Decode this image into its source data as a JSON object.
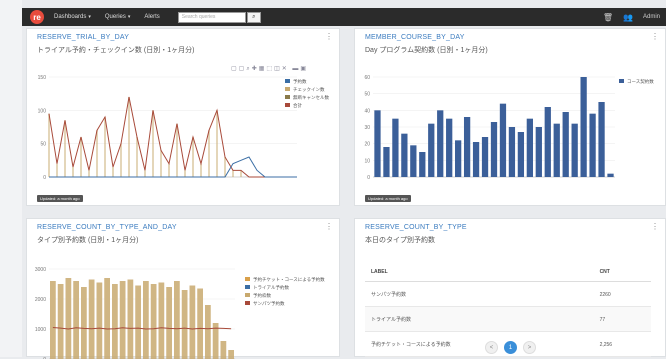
{
  "topbar": {
    "logo_text": "re",
    "nav": [
      {
        "label": "Dashboards",
        "caret": true
      },
      {
        "label": "Queries",
        "caret": true
      },
      {
        "label": "Alerts",
        "caret": false
      }
    ],
    "search_placeholder": "Search queries",
    "user": "Admin"
  },
  "panels": {
    "p1": {
      "title": "RESERVE_TRIAL_BY_DAY",
      "subtitle": "トライアル予約・チェックイン数 (日別・1ヶ月分)",
      "updated": "Updated: a month ago"
    },
    "p2": {
      "title": "MEMBER_COURSE_BY_DAY",
      "subtitle": "Day プログラム契約数 (日別・1ヶ月分)",
      "updated": "Updated: a month ago"
    },
    "p3": {
      "title": "RESERVE_COUNT_BY_TYPE_AND_DAY",
      "subtitle": "タイプ別予約数 (日別・1ヶ月分)"
    },
    "p4": {
      "title": "RESERVE_COUNT_BY_TYPE",
      "subtitle": "本日のタイプ別予約数"
    }
  },
  "table": {
    "headers": [
      "LABEL",
      "CNT"
    ],
    "rows": [
      {
        "label": "サンパツ予約数",
        "cnt": "2260"
      },
      {
        "label": "トライアル予約数",
        "cnt": "77"
      },
      {
        "label": "予約チケット・コースによる予約数",
        "cnt": "2,256"
      }
    ],
    "pages": [
      "<",
      "1",
      ">"
    ]
  },
  "chart_data": [
    {
      "type": "line",
      "legend": [
        "予約数",
        "チェックイン数",
        "無断キャンセル数",
        "合計"
      ],
      "colors": [
        "#3b6ea5",
        "#c8a96e",
        "#8a7a4a",
        "#a84a3a"
      ],
      "ylim": [
        0,
        150
      ],
      "yticks": [
        0,
        50,
        100,
        150
      ],
      "series": [
        {
          "name": "合計",
          "values": [
            95,
            20,
            85,
            15,
            60,
            10,
            70,
            90,
            15,
            50,
            120,
            60,
            10,
            100,
            40,
            20,
            80,
            10,
            60,
            20,
            70,
            100,
            30,
            10,
            10,
            0,
            0,
            0,
            0,
            0,
            0,
            0
          ]
        },
        {
          "name": "予約数",
          "values": [
            0,
            0,
            0,
            0,
            0,
            0,
            0,
            0,
            0,
            0,
            0,
            0,
            0,
            0,
            0,
            0,
            0,
            0,
            0,
            0,
            0,
            0,
            0,
            20,
            25,
            30,
            10,
            0,
            0,
            0,
            0,
            0
          ]
        }
      ],
      "legend_position": "right"
    },
    {
      "type": "bar",
      "legend": [
        "コース契約数"
      ],
      "colors": [
        "#3b5f99"
      ],
      "ylim": [
        0,
        60
      ],
      "yticks": [
        0,
        10,
        20,
        30,
        40,
        50,
        60
      ],
      "values": [
        40,
        18,
        35,
        26,
        19,
        15,
        32,
        40,
        35,
        22,
        36,
        21,
        24,
        33,
        44,
        30,
        27,
        35,
        30,
        42,
        32,
        39,
        32,
        60,
        38,
        45,
        2
      ],
      "legend_position": "right"
    },
    {
      "type": "bar",
      "legend": [
        "予約チケット・コースによる予約数",
        "トライアル予約数",
        "予約枠数",
        "サンパツ予約数"
      ],
      "colors": [
        "#d9a04a",
        "#3b6ea5",
        "#c8a96e",
        "#a84a3a"
      ],
      "ylim": [
        0,
        3000
      ],
      "yticks": [
        0,
        1000,
        2000,
        3000
      ],
      "values": [
        2600,
        2500,
        2700,
        2600,
        2400,
        2650,
        2550,
        2700,
        2500,
        2600,
        2650,
        2450,
        2600,
        2500,
        2550,
        2400,
        2600,
        2300,
        2450,
        2350,
        1800,
        1200,
        600,
        300
      ],
      "line": [
        1050,
        1030,
        1000,
        1040,
        1020,
        1010,
        1030,
        1000,
        1010,
        1040,
        1020,
        1030,
        1000,
        1010,
        1040,
        1020,
        1010,
        1030,
        1000,
        1020,
        1010,
        1030,
        1020,
        1010
      ],
      "legend_position": "right"
    }
  ]
}
